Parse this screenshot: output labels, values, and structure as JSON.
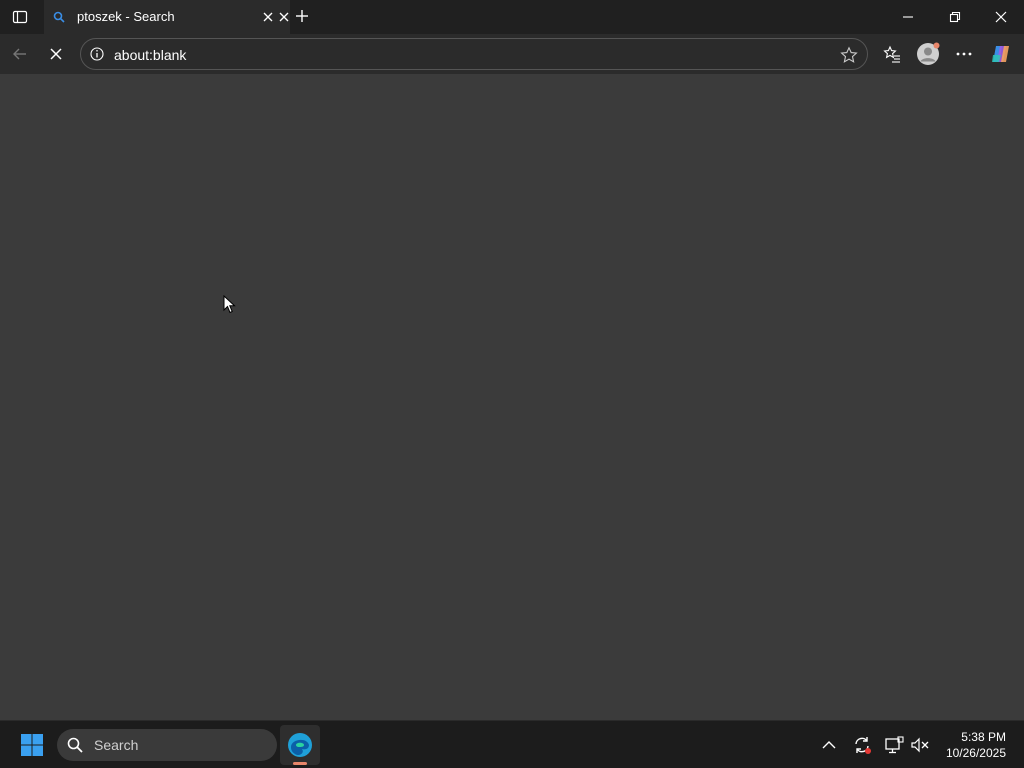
{
  "browser": {
    "tab": {
      "title": "ptoszek - Search"
    },
    "address_bar": {
      "url": "about:blank"
    }
  },
  "taskbar": {
    "search": {
      "placeholder": "Search"
    },
    "clock": {
      "time": "5:38 PM",
      "date": "10/26/2025"
    }
  },
  "colors": {
    "titlebar": "#202020",
    "toolbar": "#2b2b2b",
    "content": "#3b3b3b",
    "taskbar": "#1c1c1c",
    "accent": "#3a8ee6"
  }
}
